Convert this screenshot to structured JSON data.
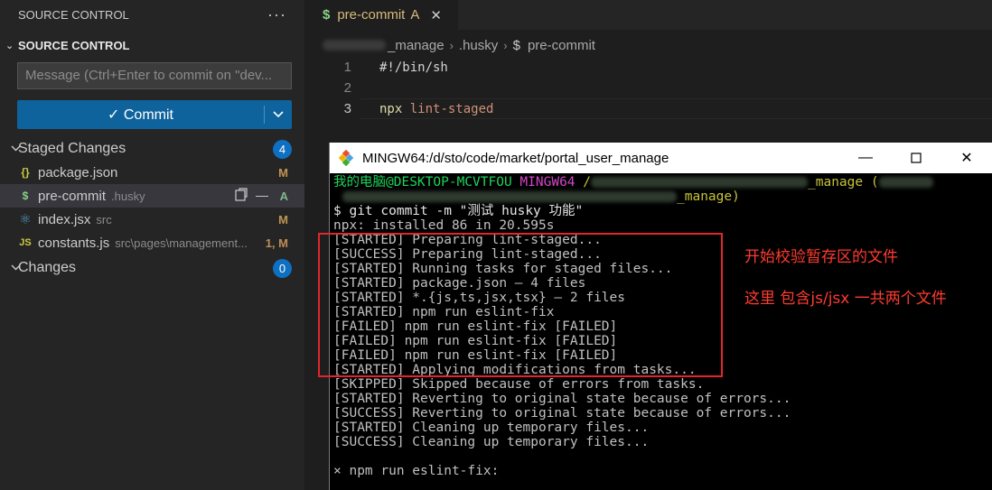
{
  "sidebar": {
    "header": "SOURCE CONTROL",
    "more_icon": "ellipsis-icon",
    "section_title": "SOURCE CONTROL",
    "message_placeholder": "Message (Ctrl+Enter to commit on \"dev...",
    "commit_label": "✓ Commit",
    "staged_label": "Staged Changes",
    "staged_count": "4",
    "changes_label": "Changes",
    "changes_count": "0",
    "files": [
      {
        "icon": "{}",
        "icon_name": "json-file-icon",
        "color": "#cbcb41",
        "name": "package.json",
        "path": "",
        "status": "M",
        "status_color": "#c09553"
      },
      {
        "icon": "$",
        "icon_name": "shell-file-icon",
        "color": "#89d185",
        "name": "pre-commit",
        "path": ".husky",
        "status": "A",
        "status_color": "#81b88b"
      },
      {
        "icon": "⚛",
        "icon_name": "react-file-icon",
        "color": "#519aba",
        "name": "index.jsx",
        "path": "src",
        "status": "M",
        "status_color": "#c09553"
      },
      {
        "icon": "JS",
        "icon_name": "javascript-file-icon",
        "color": "#cbcb41",
        "name": "constants.js",
        "path": "src\\pages\\management...",
        "status": "1, M",
        "status_color": "#c08c55"
      }
    ]
  },
  "editor": {
    "tab_icon": "$",
    "tab_name": "pre-commit",
    "tab_status": "A",
    "breadcrumb": [
      "_manage",
      ".husky",
      "pre-commit"
    ],
    "lines": [
      {
        "num": "1",
        "text": "#!/bin/sh"
      },
      {
        "num": "2",
        "text": ""
      },
      {
        "num": "3",
        "cmd": "npx",
        "arg": "lint-staged"
      }
    ]
  },
  "terminal": {
    "title": "MINGW64:/d/sto/code/market/portal_user_manage",
    "prompt_user": "我的电脑@DESKTOP-MCVTFOU",
    "prompt_env": "MINGW64",
    "prompt_path_start": "/",
    "prompt_path_end": "_manage (",
    "prompt_line2_end": "_manage)",
    "command": "$ git commit -m \"测试 husky 功能\"",
    "output": [
      "npx: installed 86 in 20.595s",
      "[STARTED] Preparing lint-staged...",
      "[SUCCESS] Preparing lint-staged...",
      "[STARTED] Running tasks for staged files...",
      "[STARTED] package.json — 4 files",
      "[STARTED] *.{js,ts,jsx,tsx} — 2 files",
      "[STARTED] npm run eslint-fix",
      "[FAILED] npm run eslint-fix [FAILED]",
      "[FAILED] npm run eslint-fix [FAILED]",
      "[FAILED] npm run eslint-fix [FAILED]",
      "[STARTED] Applying modifications from tasks...",
      "[SKIPPED] Skipped because of errors from tasks.",
      "[STARTED] Reverting to original state because of errors...",
      "[SUCCESS] Reverting to original state because of errors...",
      "[STARTED] Cleaning up temporary files...",
      "[SUCCESS] Cleaning up temporary files...",
      "",
      "× npm run eslint-fix:"
    ]
  },
  "annotations": {
    "note1": "开始校验暂存区的文件",
    "note2": "这里 包含js/jsx 一共两个文件"
  }
}
